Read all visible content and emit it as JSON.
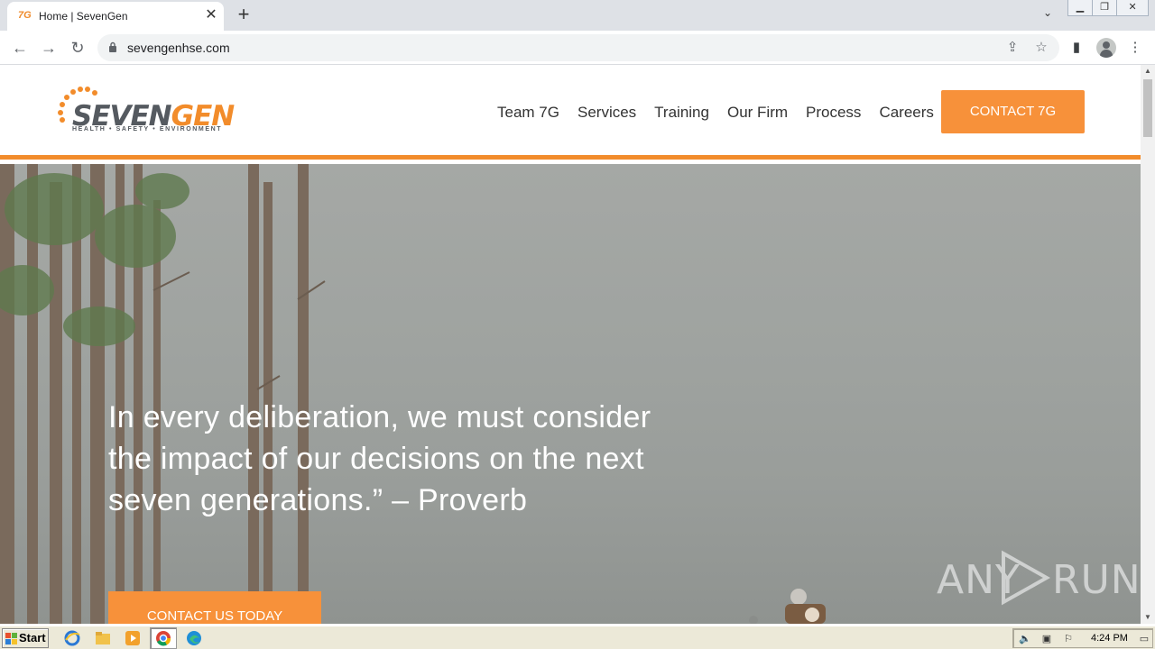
{
  "browser": {
    "tab": {
      "favicon_text": "7G",
      "title": "Home | SevenGen"
    },
    "url": "sevengenhse.com"
  },
  "site": {
    "logo": {
      "word_part1": "SEVEN",
      "word_part2": "GEN",
      "tagline": "HEALTH • SAFETY • ENVIRONMENT"
    },
    "nav": [
      "Team 7G",
      "Services",
      "Training",
      "Our Firm",
      "Process",
      "Careers"
    ],
    "contact_button": "CONTACT 7G",
    "hero": {
      "quote": "In every deliberation, we must consider the impact of our decisions on the next seven generations.” – Proverb",
      "cta": "CONTACT US TODAY"
    },
    "watermark": {
      "left": "ANY",
      "right": "RUN"
    }
  },
  "colors": {
    "accent": "#f7913a",
    "rule": "#f28c2b"
  },
  "taskbar": {
    "start_label": "Start",
    "clock": "4:24 PM"
  }
}
